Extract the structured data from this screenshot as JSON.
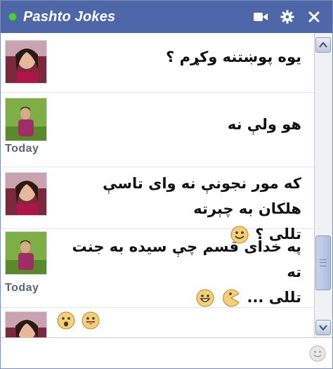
{
  "window": {
    "title": "Pashto Jokes",
    "icons": [
      "video-icon",
      "gear-icon",
      "close-icon"
    ]
  },
  "messages": [
    {
      "text_lines": [
        "یوه پوښتنه وکړم ؟"
      ],
      "today_label": "",
      "emoticons": []
    },
    {
      "text_lines": [
        "هو ولې نه"
      ],
      "today_label": "Today",
      "emoticons": []
    },
    {
      "text_lines": [
        "که مور نجونې نه وای تاسې هلکان به چېرته",
        "تللی ؟"
      ],
      "today_label": "",
      "emoticons": [
        "smile"
      ]
    },
    {
      "text_lines": [
        "په خدای قسم چې سیده به جنت ته",
        "تللی ..."
      ],
      "today_label": "Today",
      "emoticons": [
        "grin",
        "pacman"
      ]
    },
    {
      "text_lines": [
        ""
      ],
      "today_label": "",
      "emoticons": [
        "surprised",
        "tongue"
      ]
    }
  ],
  "scrollbar": {
    "position": 0.85
  },
  "input": {
    "value": "",
    "placeholder": ""
  },
  "colors": {
    "titlebar": "#4e67a9",
    "status": "#51c94f",
    "emoticon": "#f2cf7a"
  }
}
